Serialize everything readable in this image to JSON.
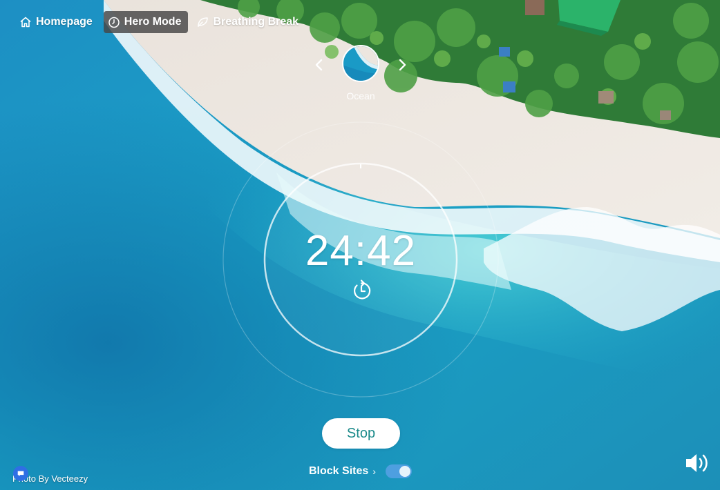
{
  "nav": {
    "items": [
      {
        "label": "Homepage",
        "icon": "home-icon",
        "active": false
      },
      {
        "label": "Hero Mode",
        "icon": "clock-icon",
        "active": true
      },
      {
        "label": "Breathing Break",
        "icon": "leaf-icon",
        "active": false
      }
    ]
  },
  "scene": {
    "label": "Ocean",
    "prev_icon": "chevron-left-icon",
    "next_icon": "chevron-right-icon"
  },
  "timer": {
    "time": "24:42",
    "icon": "timer-restart-icon"
  },
  "controls": {
    "stop_label": "Stop",
    "block_sites_label": "Block Sites",
    "block_sites_chevron": "›",
    "block_sites_enabled": true
  },
  "footer": {
    "credit": "Photo By Vecteezy",
    "chat_icon": "chat-icon",
    "volume_icon": "volume-icon"
  },
  "colors": {
    "active_nav_bg": "#464646",
    "stop_text": "#1a8a8a",
    "toggle_on": "#4e9fe0",
    "chat_button": "#2f6fe4"
  }
}
